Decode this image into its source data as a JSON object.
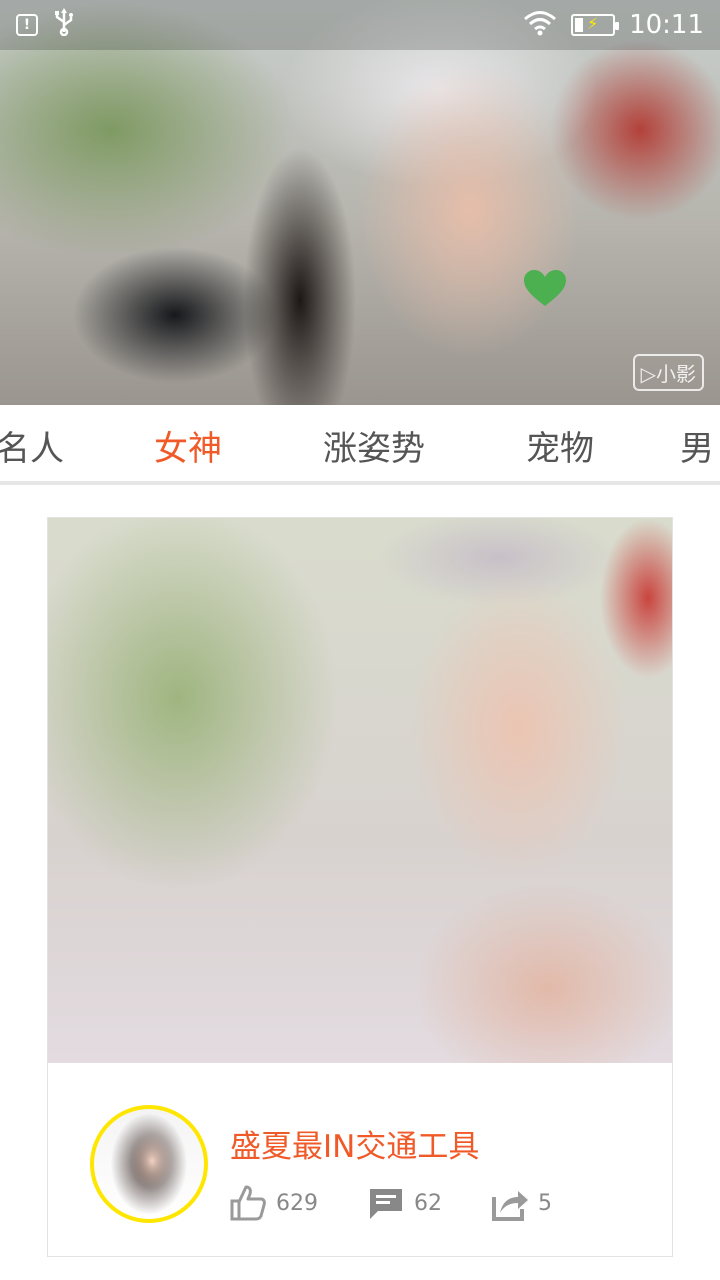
{
  "status_bar": {
    "time": "10:11",
    "icons": [
      "notification-icon",
      "usb-icon",
      "wifi-icon",
      "battery-charging-icon"
    ]
  },
  "hero": {
    "watermark": "▷小影",
    "like_icon": "heart-icon",
    "like_color": "#4caf50"
  },
  "tabs": {
    "items": [
      {
        "label": "名人"
      },
      {
        "label": "女神"
      },
      {
        "label": "涨姿势"
      },
      {
        "label": "宠物"
      },
      {
        "label": "男"
      }
    ],
    "active": "女神",
    "accent_color": "#f05a28"
  },
  "card": {
    "title": "盛夏最IN交通工具",
    "likes": "629",
    "comments": "62",
    "shares": "5",
    "avatar_border_color": "#ffe600"
  }
}
